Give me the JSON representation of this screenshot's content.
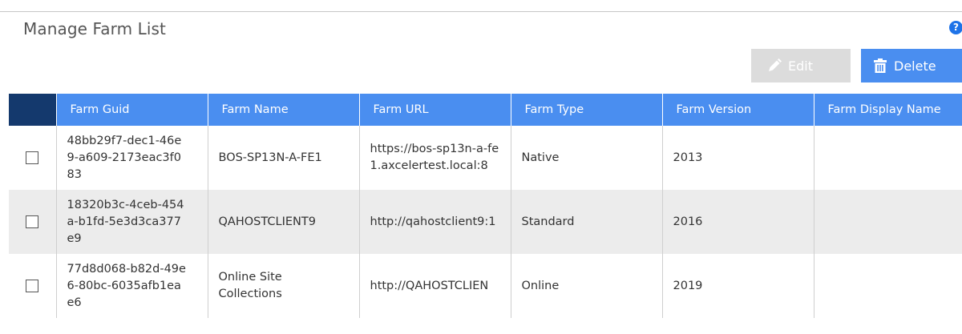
{
  "page": {
    "title": "Manage Farm List"
  },
  "help": {
    "glyph": "?"
  },
  "toolbar": {
    "edit_label": "Edit",
    "edit_icon": "pencil-icon",
    "delete_label": "Delete",
    "delete_icon": "trash-icon"
  },
  "table": {
    "columns": [
      "Farm Guid",
      "Farm Name",
      "Farm URL",
      "Farm Type",
      "Farm Version",
      "Farm Display Name"
    ],
    "rows": [
      {
        "guid": "48bb29f7-dec1-46e9-a609-2173eac3f083",
        "name": "BOS-SP13N-A-FE1",
        "url": "https://bos-sp13n-a-fe1.axcelertest.local:8",
        "type": "Native",
        "version": "2013",
        "display_name": ""
      },
      {
        "guid": "18320b3c-4ceb-454a-b1fd-5e3d3ca377e9",
        "name": "QAHOSTCLIENT9",
        "url": "http://qahostclient9:1",
        "type": "Standard",
        "version": "2016",
        "display_name": ""
      },
      {
        "guid": "77d8d068-b82d-49e6-80bc-6035afb1eae6",
        "name": "Online Site Collections",
        "url": "http://QAHOSTCLIEN",
        "type": "Online",
        "version": "2019",
        "display_name": ""
      }
    ]
  },
  "colors": {
    "header_blue": "#4a8ef0",
    "select_header_navy": "#14396d",
    "alt_row_gray": "#ececec",
    "disabled_button_gray": "#dcdcdc"
  }
}
